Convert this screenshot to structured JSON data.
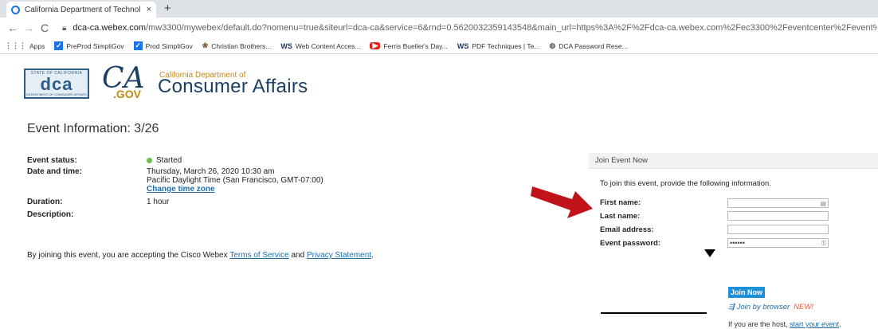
{
  "browser": {
    "tab_title": "California Department of Technol",
    "tab_close": "×",
    "new_tab": "+",
    "url_host": "dca-ca.webex.com",
    "url_path": "/mw3300/mywebex/default.do?nomenu=true&siteurl=dca-ca&service=6&rnd=0.5620032359143548&main_url=https%3A%2F%2Fdca-ca.webex.com%2Fec3300%2Feventcenter%2Fevent%2FeventAction.do%3F",
    "bookmarks": [
      {
        "label": "Apps",
        "icon": "apps-icon",
        "glyph": "⋮⋮⋮"
      },
      {
        "label": "PreProd SimpliGov",
        "icon": "check-icon",
        "glyph": "✓"
      },
      {
        "label": "Prod SimpliGov",
        "icon": "check-icon",
        "glyph": "✓"
      },
      {
        "label": "Christian Brothers...",
        "icon": "seal-icon",
        "glyph": "❀"
      },
      {
        "label": "Web Content Acces...",
        "icon": "ws-icon",
        "glyph": "WS"
      },
      {
        "label": "Ferris Bueller's Day...",
        "icon": "youtube-icon",
        "glyph": "▶"
      },
      {
        "label": "PDF Techniques | Te...",
        "icon": "ws-icon",
        "glyph": "WS"
      },
      {
        "label": "DCA Password Rese...",
        "icon": "globe-icon",
        "glyph": "◍"
      }
    ]
  },
  "logo": {
    "dca_top": "STATE OF CALIFORNIA",
    "dca_text": "dca",
    "dca_bottom": "DEPARTMENT OF CONSUMER AFFAIRS",
    "ca_text": "CA",
    "gov_text": ".GOV",
    "dept_small": "California Department of",
    "dept_big": "Consumer Affairs"
  },
  "event": {
    "heading": "Event Information: 3/26",
    "status_label": "Event status:",
    "status_value": "Started",
    "datetime_label": "Date and time:",
    "datetime_line1": "Thursday, March 26, 2020 10:30 am",
    "datetime_line2": "Pacific Daylight Time (San Francisco, GMT-07:00)",
    "change_tz": "Change time zone",
    "duration_label": "Duration:",
    "duration_value": "1 hour",
    "description_label": "Description:"
  },
  "terms": {
    "prefix": "By joining this event, you are accepting the Cisco Webex ",
    "tos_link": "Terms of Service",
    "and": " and ",
    "privacy_link": "Privacy Statement",
    "suffix": "."
  },
  "join": {
    "header": "Join Event Now",
    "instructions": "To join this event, provide the following information.",
    "first_name_label": "First name:",
    "last_name_label": "Last name:",
    "email_label": "Email address:",
    "password_label": "Event password:",
    "password_value": "••••••",
    "join_button": "Join Now",
    "browser_join_icon": "⇶",
    "browser_join": "Join by browser",
    "browser_join_new": "NEW!",
    "host_prefix": "If you are the host, ",
    "host_link": "start your event",
    "host_suffix": "."
  },
  "colors": {
    "arrow": "#c0141a",
    "link": "#1e6fa8",
    "join_button": "#1e90d8",
    "status_started": "#6cc04a"
  }
}
